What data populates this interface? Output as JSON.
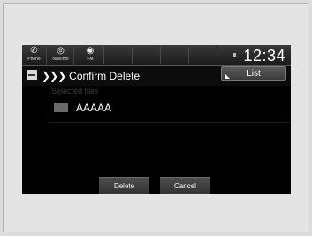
{
  "topbar": {
    "phone_label": "Phone",
    "navi_label": "NaviInfo",
    "fm_label": "FM",
    "clock": "12:34"
  },
  "header": {
    "chevrons": "❯❯❯",
    "title": "Confirm Delete",
    "list_button": "List"
  },
  "main": {
    "section_label": "Selected files",
    "files": [
      "AAAAA"
    ]
  },
  "actions": {
    "delete_label": "Delete",
    "cancel_label": "Cancel"
  },
  "colors": {
    "screen_bg": "#000000",
    "text": "#ffffff",
    "muted_text": "#3c3c3c",
    "button_bg": "#3f3f3f"
  },
  "icons": {
    "phone": "phone-icon",
    "navi": "navi-icon",
    "fm": "radio-icon",
    "title": "file-icon"
  }
}
